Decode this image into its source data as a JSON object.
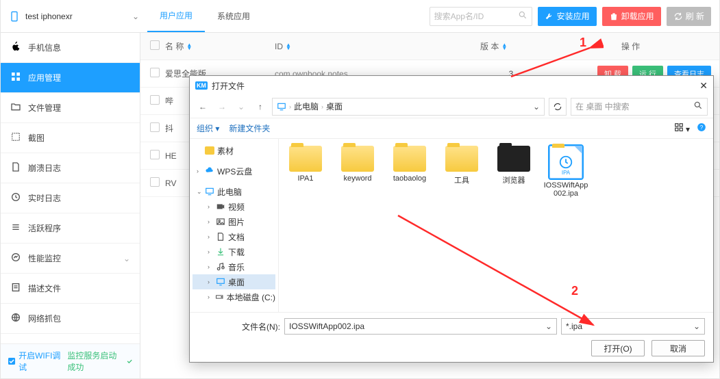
{
  "device": {
    "name": "test iphonexr"
  },
  "tabs": {
    "user_apps": "用户应用",
    "system_apps": "系统应用"
  },
  "toolbar": {
    "search_placeholder": "搜索App名/ID",
    "install": "安装应用",
    "uninstall": "卸载应用",
    "refresh": "刷 新"
  },
  "sidebar": {
    "items": [
      {
        "label": "手机信息",
        "icon": "apple-icon"
      },
      {
        "label": "应用管理",
        "icon": "grid-icon",
        "active": true
      },
      {
        "label": "文件管理",
        "icon": "folder-icon"
      },
      {
        "label": "截图",
        "icon": "scissors-icon"
      },
      {
        "label": "崩溃日志",
        "icon": "doc-icon"
      },
      {
        "label": "实时日志",
        "icon": "clock-icon"
      },
      {
        "label": "活跃程序",
        "icon": "list-icon"
      },
      {
        "label": "性能监控",
        "icon": "chart-icon",
        "expandable": true
      },
      {
        "label": "描述文件",
        "icon": "doc2-icon"
      },
      {
        "label": "网络抓包",
        "icon": "net-icon"
      }
    ],
    "footer": {
      "wifi_debug": "开启WIFI调试",
      "monitor_ok": "监控服务启动成功"
    }
  },
  "table": {
    "headers": {
      "name": "名 称",
      "id": "ID",
      "version": "版 本",
      "ops": "操 作"
    },
    "rows": [
      {
        "name": "爱思全能版",
        "id": "com.ownbook.notes",
        "version": "3"
      },
      {
        "name": "哔",
        "id": "",
        "version": ""
      },
      {
        "name": "抖",
        "id": "",
        "version": ""
      },
      {
        "name": "HE",
        "id": "",
        "version": ""
      },
      {
        "name": "RV",
        "id": "",
        "version": ""
      }
    ],
    "ops": {
      "uninstall": "卸 载",
      "run": "运 行",
      "view_log": "查看日志"
    }
  },
  "dialog": {
    "title": "打开文件",
    "km_badge": "KM",
    "breadcrumb": {
      "root": "此电脑",
      "folder": "桌面"
    },
    "search_placeholder": "在 桌面 中搜索",
    "organize": "组织",
    "new_folder": "新建文件夹",
    "tree": [
      {
        "label": "素材",
        "icon": "folder-y",
        "indent": 0
      },
      {
        "label": "WPS云盘",
        "icon": "cloud",
        "indent": 0,
        "caret": ">"
      },
      {
        "label": "此电脑",
        "icon": "pc",
        "indent": 0,
        "caret": "v"
      },
      {
        "label": "视频",
        "icon": "video",
        "indent": 1,
        "caret": ">"
      },
      {
        "label": "图片",
        "icon": "image",
        "indent": 1,
        "caret": ">"
      },
      {
        "label": "文档",
        "icon": "doc",
        "indent": 1,
        "caret": ">"
      },
      {
        "label": "下载",
        "icon": "download",
        "indent": 1,
        "caret": ">"
      },
      {
        "label": "音乐",
        "icon": "music",
        "indent": 1,
        "caret": ">"
      },
      {
        "label": "桌面",
        "icon": "desktop",
        "indent": 1,
        "caret": ">",
        "selected": true
      },
      {
        "label": "本地磁盘 (C:)",
        "icon": "disk",
        "indent": 1,
        "caret": ">"
      }
    ],
    "files": [
      {
        "name": "IPA1",
        "type": "folder"
      },
      {
        "name": "keyword",
        "type": "folder"
      },
      {
        "name": "taobaolog",
        "type": "folder"
      },
      {
        "name": "工具",
        "type": "folder"
      },
      {
        "name": "浏览器",
        "type": "folder-dark"
      },
      {
        "name": "IOSSWiftApp002.ipa",
        "type": "ipa-file",
        "ipa_tag": "IPA",
        "selected": true
      }
    ],
    "filename_label": "文件名(N):",
    "filename_value": "IOSSWiftApp002.ipa",
    "filetype_value": "*.ipa",
    "open_btn": "打开(O)",
    "cancel_btn": "取消"
  },
  "annotations": {
    "one": "1",
    "two": "2"
  }
}
